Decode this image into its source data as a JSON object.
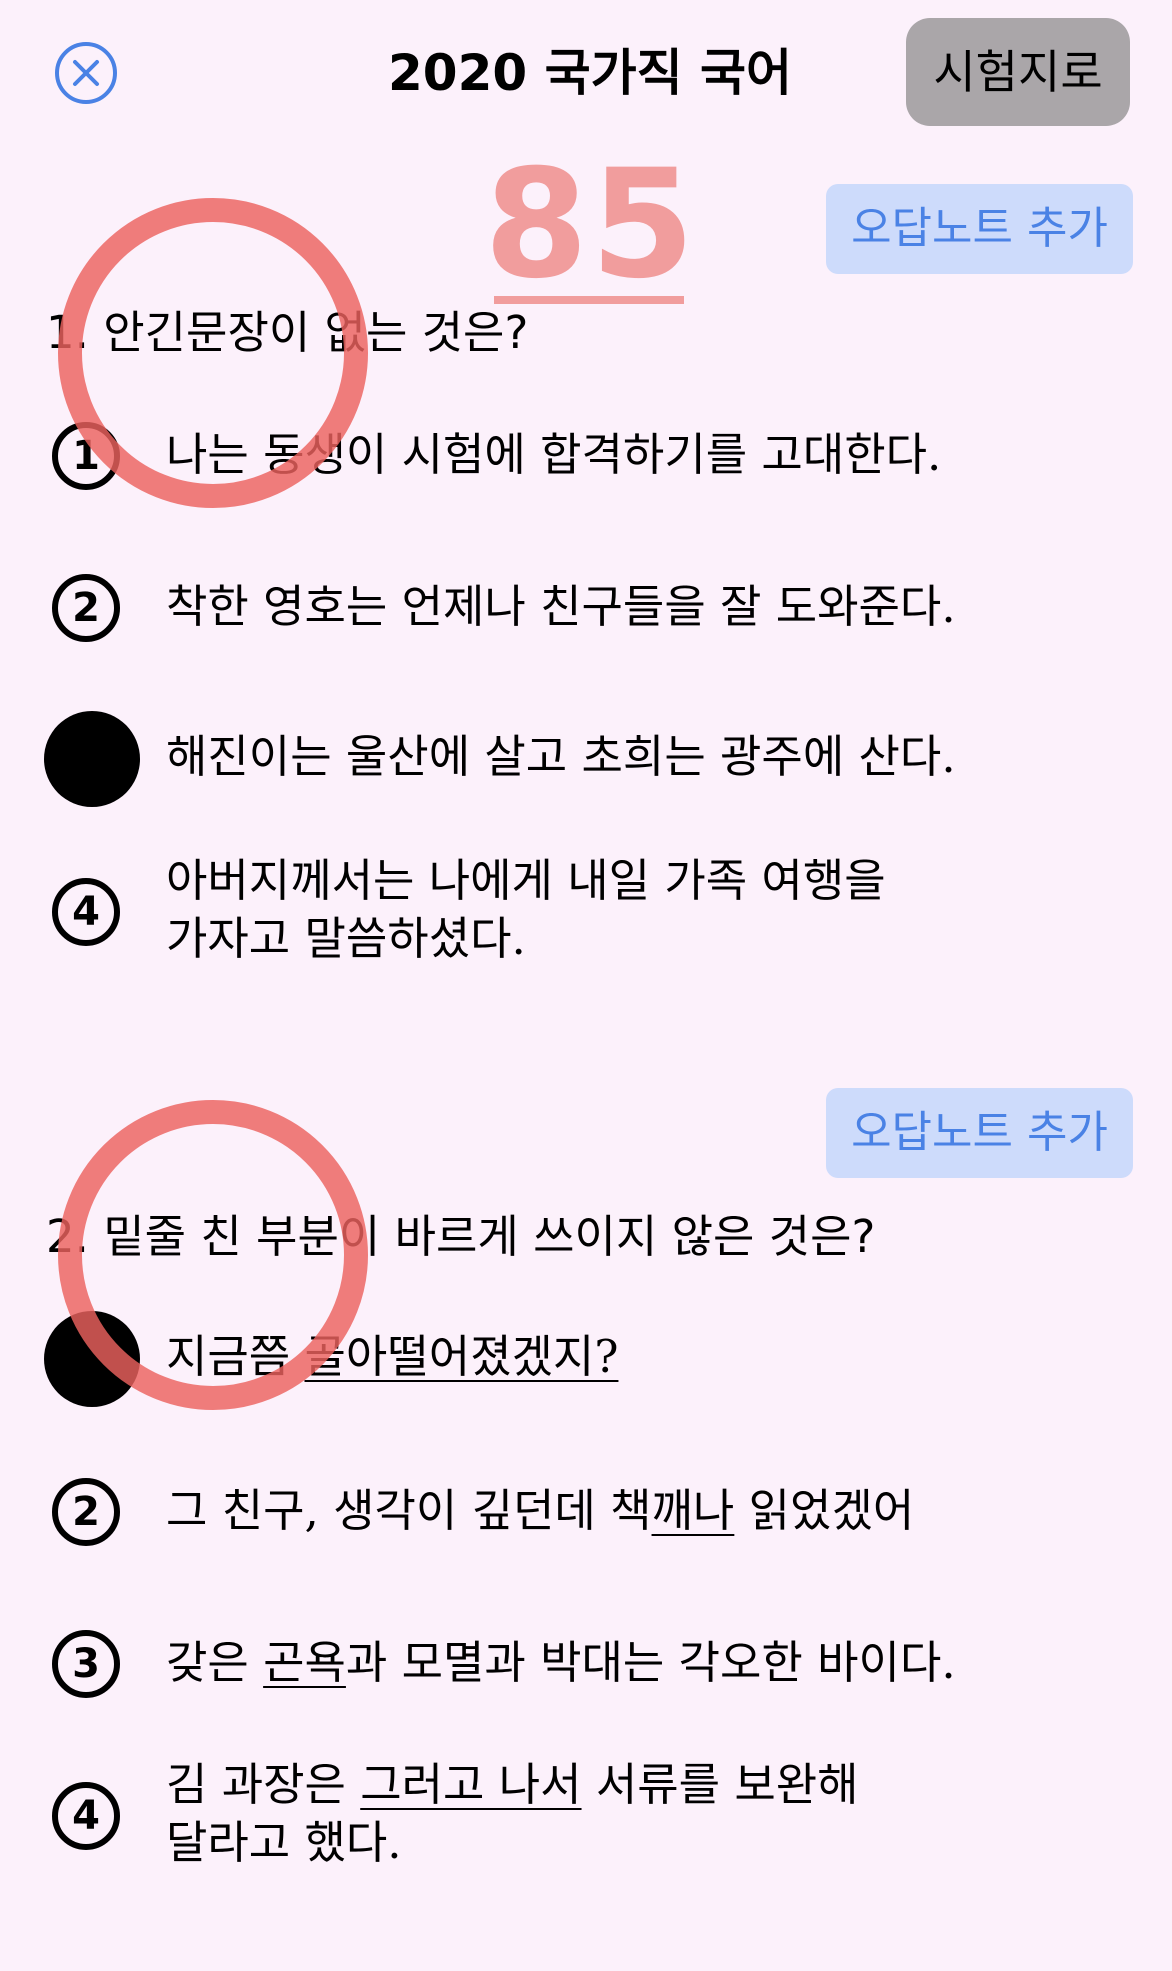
{
  "header": {
    "title": "2020 국가직 국어",
    "to_exam_label": "시험지로",
    "close_icon": "close-circle-icon",
    "accent": "#4a82e5"
  },
  "score": "85",
  "wrong_note_label": "오답노트 추가",
  "questions": [
    {
      "number": "1.",
      "text": "안긴문장이 없는 것은?",
      "result": "wrong",
      "options": [
        {
          "num": "1",
          "text": "나는 동생이 시험에 합격하기를 고대한다.",
          "selected": false
        },
        {
          "num": "2",
          "text": "착한 영호는 언제나 친구들을 잘 도와준다.",
          "selected": false
        },
        {
          "num": "3",
          "text": "해진이는 울산에 살고 초희는 광주에 산다.",
          "selected": true
        },
        {
          "num": "4",
          "line1": "아버지께서는 나에게 내일 가족 여행을",
          "line2": "가자고 말씀하셨다.",
          "selected": false
        }
      ]
    },
    {
      "number": "2.",
      "text": "밑줄 친 부분이 바르게 쓰이지 않은 것은?",
      "result": "wrong",
      "options": [
        {
          "num": "1",
          "pre": "지금쯤 ",
          "underlined": "골아떨어졌겠지?",
          "post": "",
          "selected": true
        },
        {
          "num": "2",
          "pre": "그 친구, 생각이 깊던데 책",
          "underlined": "깨나",
          "post": " 읽었겠어",
          "selected": false
        },
        {
          "num": "3",
          "pre": "갖은 ",
          "underlined": "곤욕",
          "post": "과 모멸과 박대는 각오한 바이다.",
          "selected": false
        },
        {
          "num": "4",
          "pre": "김 과장은 ",
          "underlined": "그러고 나서",
          "post": " 서류를 보완해",
          "line2": "달라고 했다.",
          "selected": false
        }
      ]
    }
  ],
  "colors": {
    "background": "#fcf1fb",
    "score": "#f19d9d",
    "wrong_mark": "#ec625e",
    "button_gray": "#aaa6a9",
    "wrong_note_bg": "#cddbfb"
  }
}
